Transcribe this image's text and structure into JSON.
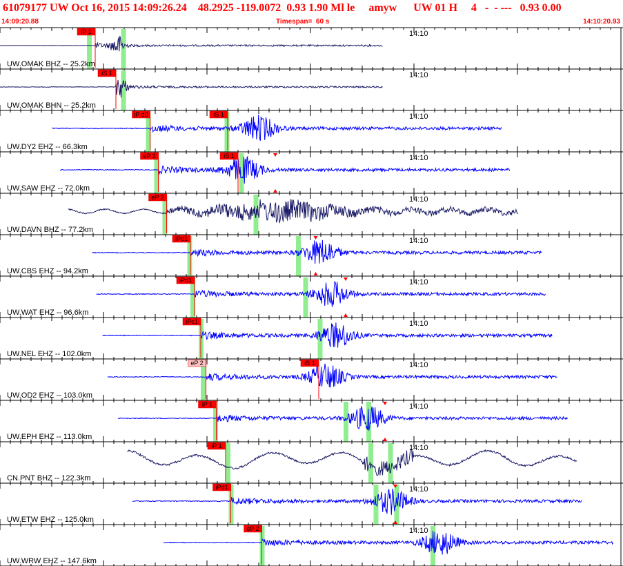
{
  "header": {
    "title": "61079177 UW Oct 16, 2015 14:09:26.24    48.2925 -119.0072  0.93 1.90 Ml le     amyw      UW 01 H     4   -  - ---   0.93 0.00",
    "start_time": "14:09:20.88",
    "timespan": "Timespan=  60 s",
    "end_time": "14:10:20.93"
  },
  "colors": {
    "title": "#ff0000",
    "trace_blue": "#0000ff",
    "trace_dark": "#1a1a66",
    "pick_box": "#ff0000",
    "pick_box_light": "#ffc0c0",
    "window_band": "#90ee90",
    "grid_line": "#000000"
  },
  "traces": [
    {
      "label": "UW.OMAK BHZ -- 25.2km",
      "time_tick": "14:10",
      "color": "dark",
      "picks": [
        {
          "text": "iP 1",
          "t": 9.2,
          "style": "solid"
        }
      ],
      "bands": [
        8.6,
        11.9
      ],
      "burst": 11.4,
      "kind": "local"
    },
    {
      "label": "UW.OMAK BHN -- 25.2km",
      "time_tick": "14:10",
      "color": "dark",
      "picks": [
        {
          "text": "iS 1",
          "t": 11.2,
          "style": "solid"
        }
      ],
      "bands": [
        11.9
      ],
      "burst": 11.6,
      "kind": "local"
    },
    {
      "label": "UW.DY2 EHZ -- 66.3km",
      "time_tick": "14:10",
      "color": "blue",
      "picks": [
        {
          "text": "iP d0",
          "t": 14.5,
          "style": "solid"
        },
        {
          "text": "iS 1",
          "t": 22.0,
          "style": "solid"
        }
      ],
      "bands": [
        14.3,
        21.9
      ],
      "burst": 25.0,
      "kind": "regional"
    },
    {
      "label": "UW.SAW EHZ -- 72.0km",
      "time_tick": "14:10",
      "color": "blue",
      "picks": [
        {
          "text": "eP 2",
          "t": 15.3,
          "style": "solid"
        },
        {
          "text": "iS 1",
          "t": 23.0,
          "style": "solid"
        }
      ],
      "bands": [
        15.1,
        23.3
      ],
      "burst": 23.5,
      "markers": [
        26.6
      ],
      "kind": "regional"
    },
    {
      "label": "UW.DAVN BHZ -- 77.2km",
      "time_tick": "14:10",
      "color": "dark",
      "picks": [
        {
          "text": "eP 2",
          "t": 16.1,
          "style": "solid"
        }
      ],
      "bands": [
        15.9,
        24.7
      ],
      "burst": 27.0,
      "kind": "wavy"
    },
    {
      "label": "UW.CBS EHZ -- 94.2km",
      "time_tick": "14:10",
      "color": "blue",
      "picks": [
        {
          "text": "iPd1",
          "t": 18.4,
          "style": "solid"
        }
      ],
      "bands": [
        18.3,
        28.8
      ],
      "burst": 31.0,
      "markers": [
        30.5
      ],
      "kind": "regional"
    },
    {
      "label": "UW.WAT EHZ -- 96.6km",
      "time_tick": "14:10",
      "color": "blue",
      "picks": [
        {
          "text": "iPd1",
          "t": 18.8,
          "style": "solid"
        }
      ],
      "bands": [
        18.6,
        29.5
      ],
      "burst": 32.0,
      "markers": [
        33.4
      ],
      "kind": "regional"
    },
    {
      "label": "UW.NEL EHZ -- 102.0km",
      "time_tick": "14:10",
      "color": "blue",
      "picks": [
        {
          "text": "iPc1",
          "t": 19.4,
          "style": "solid"
        }
      ],
      "bands": [
        19.4,
        30.9
      ],
      "burst": 32.5,
      "kind": "regional"
    },
    {
      "label": "UW.OD2 EHZ -- 103.0km",
      "time_tick": "14:10",
      "color": "blue",
      "picks": [
        {
          "text": "eP 2",
          "t": 19.9,
          "style": "light"
        },
        {
          "text": "iS 1",
          "t": 30.8,
          "style": "solid"
        }
      ],
      "bands": [
        19.6
      ],
      "burst": 31.5,
      "kind": "regional"
    },
    {
      "label": "UW.EPH EHZ -- 113.0km",
      "time_tick": "14:10",
      "color": "blue",
      "picks": [
        {
          "text": "iP 1",
          "t": 20.9,
          "style": "solid"
        }
      ],
      "bands": [
        20.8,
        33.4,
        35.6
      ],
      "burst": 35.5,
      "markers": [
        37.2
      ],
      "kind": "regional"
    },
    {
      "label": "CN.PNT BHZ -- 122.3km",
      "time_tick": "14:10",
      "color": "dark",
      "picks": [
        {
          "text": "iP 1",
          "t": 21.8,
          "style": "solid"
        }
      ],
      "bands": [
        22.0,
        35.8,
        37.7
      ],
      "burst": 37.0,
      "kind": "longwave"
    },
    {
      "label": "UW.ETW EHZ -- 125.0km",
      "time_tick": "14:10",
      "color": "blue",
      "picks": [
        {
          "text": "iPd1",
          "t": 22.3,
          "style": "solid"
        }
      ],
      "bands": [
        22.3,
        36.3,
        38.3
      ],
      "burst": 37.8,
      "markers": [
        38.2
      ],
      "kind": "regional"
    },
    {
      "label": "UW.WRW EHZ -- 147.6km",
      "time_tick": "14:10",
      "color": "blue",
      "picks": [
        {
          "text": "eP 2",
          "t": 25.3,
          "style": "solid"
        }
      ],
      "bands": [
        25.3,
        41.8
      ],
      "burst": 42.5,
      "kind": "regional"
    }
  ]
}
